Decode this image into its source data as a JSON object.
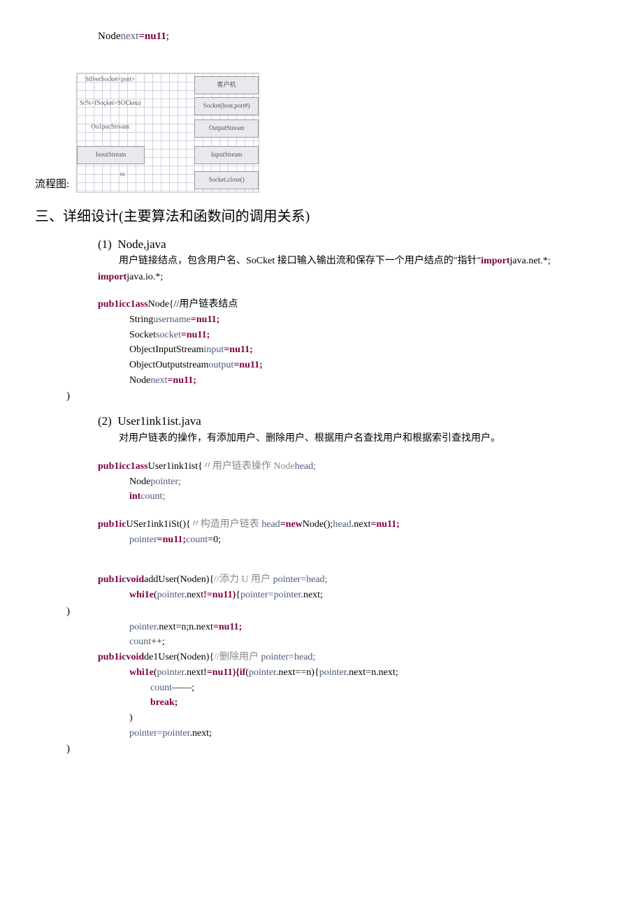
{
  "top_code": {
    "line": "Nodenext=nu11;"
  },
  "flowchart": {
    "label": "流程图:",
    "left": {
      "l1": "StfverSocket<port>",
      "l2": "Sc%<fSoçkei>SOCkeu)",
      "l3": "Ou1pucStrvam",
      "l4": "IsoutStream",
      "l5": "rs"
    },
    "right": {
      "r1": "客户机",
      "r2": "Socket(host,port#)",
      "r3": "OutputStream",
      "r4": "InputStream",
      "r5": "Socket.close()"
    }
  },
  "heading": "三、详细设计(主要算法和函数间的调用关系)",
  "sec1": {
    "num": "(1)",
    "title": "Node,java",
    "para1_a": "用户链接结点，包含用户名、SoCket 接口输入输出流和保存下一个用户结点的\"指针\"",
    "para1_b": "import",
    "para1_c": "java.net.*;",
    "imp2a": "import",
    "imp2b": "java.io.*;",
    "c1a": "pub1icc1ass",
    "c1b": "Node{//用户链表结点",
    "c2a": "String",
    "c2b": "username",
    "c2c": "=nu11;",
    "c3a": "Socket",
    "c3b": "socket",
    "c3c": "=nu11;",
    "c4a": "ObjectInputStream",
    "c4b": "input",
    "c4c": "=nu11;",
    "c5a": "ObjectOutputstream",
    "c5b": "output",
    "c5c": "=nu11;",
    "c6a": "Node",
    "c6b": "next",
    "c6c": "=nu11;",
    "close": ")"
  },
  "sec2": {
    "num": "(2)",
    "title": "User1ink1ist.java",
    "para": "对用户链表的操作，有添加用户、删除用户、根据用户名查找用户和根据索引查找用户。",
    "l1a": "pub1icc1ass",
    "l1b": "User1ink1ist{",
    "l1c": "〃用户链表操作 Node",
    "l1d": "head;",
    "l2a": "Node",
    "l2b": "pointer;",
    "l3a": "int",
    "l3b": "count;",
    "l4a": "pub1ic",
    "l4b": "USer1ink1iSt(){",
    "l4c": "〃构造用户链表 ",
    "l4d": "head",
    "l4e": "=new",
    "l4f": "Node();",
    "l4g": "head",
    "l4h": ".next",
    "l4i": "=nu11;",
    "l5a": "pointer",
    "l5b": "=nu11;",
    "l5c": "count",
    "l5d": "=0;",
    "l6a": "pub1icvoid",
    "l6b": "addUser(Noden){",
    "l6c": "//添力 U 用户 ",
    "l6d": "pointer",
    "l6e": "=head;",
    "l7a": "whi1e",
    "l7b": "(",
    "l7c": "pointer",
    "l7d": ".next",
    "l7e": "!=nu11)",
    "l7f": "{",
    "l7g": "pointer",
    "l7h": "=pointer",
    "l7i": ".next;",
    "l8": ")",
    "l9a": "pointer",
    "l9b": ".next",
    "l9c": "=n;n.next",
    "l9d": "=nu11;",
    "l10a": "count",
    "l10b": "++;",
    "l11a": "pub1icvoid",
    "l11b": "de1User(Noden){",
    "l11c": "//删除用户 ",
    "l11d": "pointer",
    "l11e": "=head;",
    "l12a": "whi1e",
    "l12b": "(",
    "l12c": "pointer",
    "l12d": ".next",
    "l12e": "!=nu11){if",
    "l12f": "(",
    "l12g": "pointer",
    "l12h": ".next",
    "l12i": "==n){",
    "l12j": "pointer",
    "l12k": ".next",
    "l12l": "=n.next;",
    "l13a": "count",
    "l13b": "——;",
    "l14": "break;",
    "l15": ")",
    "l16a": "pointer",
    "l16b": "=pointer",
    "l16c": ".next;",
    "l17": ")"
  }
}
